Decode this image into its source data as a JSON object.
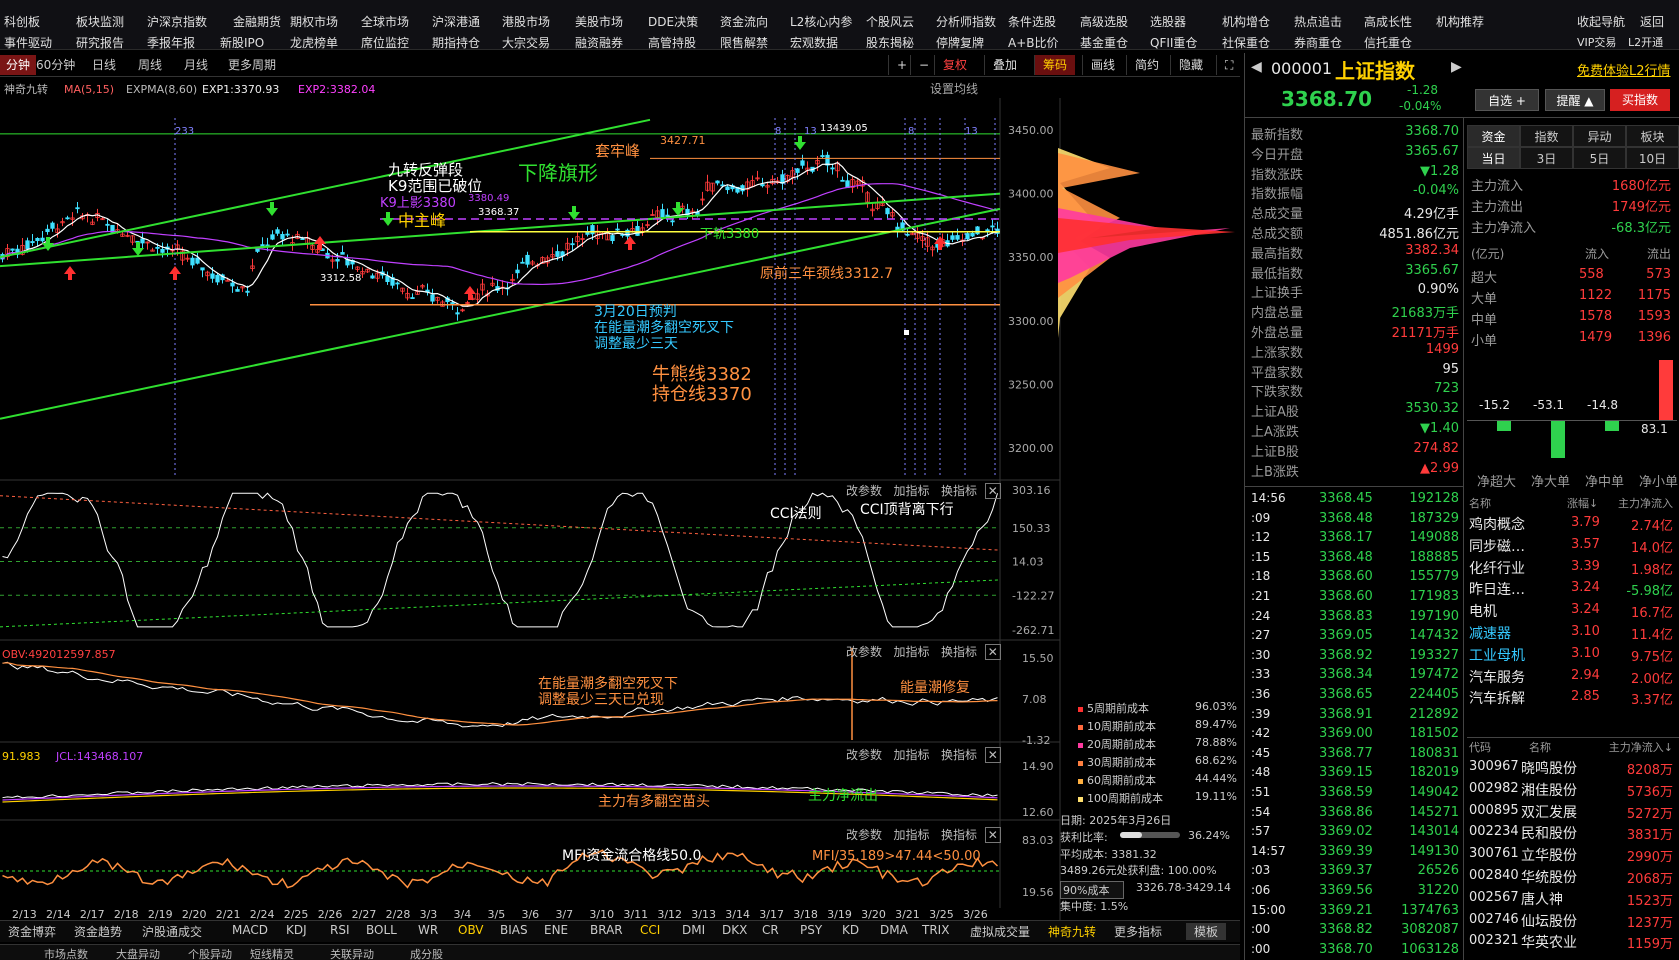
{
  "menu": {
    "row1": [
      "科创板",
      "板块监测",
      "沪深京指数",
      "金融期货",
      "期权市场",
      "全球市场",
      "沪深港通",
      "港股市场",
      "美股市场",
      "DDE决策",
      "资金流向",
      "L2核心内参",
      "个股风云",
      "分析师指数",
      "条件选股",
      "高级选股",
      "选股器",
      "机构增仓",
      "热点追击",
      "高成长性",
      "机构推荐"
    ],
    "row2": [
      "事件驱动",
      "研究报告",
      "季报年报",
      "新股IPO",
      "龙虎榜单",
      "席位监控",
      "期指持仓",
      "大宗交易",
      "融资融券",
      "高管持股",
      "限售解禁",
      "宏观数据",
      "股东揭秘",
      "停牌复牌",
      "A+B比价",
      "基金重仓",
      "QFII重仓",
      "社保重仓",
      "券商重仓",
      "信托重仓"
    ],
    "right1": [
      "收起导航",
      "返回"
    ],
    "right2": [
      "VIP交易",
      "L2开通"
    ]
  },
  "toolbar": {
    "periods": [
      "分钟",
      "60分钟",
      "日线",
      "周线",
      "月线",
      "更多周期"
    ],
    "right": [
      "复权",
      "叠加",
      "筹码",
      "画线",
      "简约",
      "隐藏"
    ]
  },
  "main_chart": {
    "indicators": [
      "神奇九转",
      "MA(5,15)",
      "EXPMA(8,60)",
      "EXP1:3370.93",
      "EXP2:3382.04"
    ],
    "settings": "设置均线",
    "yticks": [
      "3450.00",
      "3400.00",
      "3350.00",
      "3300.00",
      "3250.00",
      "3200.00"
    ],
    "annotations": {
      "taolaofeng": "套牢峰",
      "taolaofeng_val": "3427.71",
      "jiuzhuan": "九转反弹段",
      "k9": "K9范围已破位",
      "xiajiang": "下降旗形",
      "k9upper": "K9上影3380",
      "zhongzhufeng": "中主峰",
      "val_3380_49": "3380.49",
      "val_3368_37": "3368.37",
      "xiagui": "下轨3380",
      "neck": "原前三年颈线3312.7",
      "val_3312": "3312.58",
      "forecast1": "3月20日预判",
      "forecast2": "在能量潮多翻空死叉下",
      "forecast3": "调整最少三天",
      "bull1": "牛熊线3382",
      "bull2": "持仓线3370",
      "top_val": "13439.05"
    },
    "top_labels": [
      "233",
      "8",
      "13",
      "8",
      "13"
    ]
  },
  "cci_panel": {
    "tools": [
      "改参数",
      "加指标",
      "换指标"
    ],
    "yticks": [
      "303.16",
      "150.33",
      "14.03",
      "-122.27",
      "-262.71"
    ],
    "note1": "CCI法则",
    "note2": "CCI顶背离下行"
  },
  "obv_panel": {
    "label": "OBV:492012597.857",
    "tools": [
      "改参数",
      "加指标",
      "换指标"
    ],
    "yticks": [
      "15.50",
      "7.08",
      "-1.32"
    ],
    "note1": "在能量潮多翻空死叉下",
    "note2": "调整最少三天已兑现",
    "note3": "能量潮修复"
  },
  "fund_panel": {
    "label1": "91.983",
    "label2": "JCL:143468.107",
    "tools": [
      "改参数",
      "加指标",
      "换指标"
    ],
    "yticks": [
      "14.90",
      "12.60"
    ],
    "note1": "主力有多翻空苗头",
    "note2": "主力净流出"
  },
  "mfi_panel": {
    "tools": [
      "改参数",
      "加指标",
      "换指标"
    ],
    "yticks": [
      "83.03",
      "19.56"
    ],
    "note1": "MFI资金流合格线50.0",
    "note2": "MFI/35.189>47.44<50.00"
  },
  "xdates": [
    "2/13",
    "2/14",
    "2/17",
    "2/18",
    "2/19",
    "2/20",
    "2/21",
    "2/24",
    "2/25",
    "2/26",
    "2/27",
    "2/28",
    "3/3",
    "3/4",
    "3/5",
    "3/6",
    "3/7",
    "3/10",
    "3/11",
    "3/12",
    "3/13",
    "3/14",
    "3/17",
    "3/18",
    "3/19",
    "3/20",
    "3/21",
    "3/25",
    "3/26"
  ],
  "chips": {
    "costs": [
      {
        "label": "5周期前成本",
        "pct": "96.03%",
        "color": "#ff3030"
      },
      {
        "label": "10周期前成本",
        "pct": "89.47%",
        "color": "#ff6a3d"
      },
      {
        "label": "20周期前成本",
        "pct": "78.88%",
        "color": "#ff3aa0"
      },
      {
        "label": "30周期前成本",
        "pct": "68.62%",
        "color": "#ff8040"
      },
      {
        "label": "60周期前成本",
        "pct": "44.44%",
        "color": "#ffb040"
      },
      {
        "label": "100周期前成本",
        "pct": "19.11%",
        "color": "#ffe070"
      }
    ],
    "date": "日期: 2025年3月26日",
    "ratio_label": "获利比率:",
    "ratio": "36.24%",
    "avg": "平均成本: 3381.32",
    "range": "3489.26元处获利盘: 100.00%",
    "cost90": "90%成本",
    "cost90_val": "3326.78-3429.14",
    "concentration": "集中度: 1.5%"
  },
  "indicator_tabs": [
    "资金博弈",
    "资金趋势",
    "沪股通成交",
    "MACD",
    "KDJ",
    "RSI",
    "BOLL",
    "WR",
    "OBV",
    "BIAS",
    "ENE",
    "BRAR",
    "CCI",
    "DMI",
    "DKX",
    "CR",
    "PSY",
    "KD",
    "DMA",
    "TRIX",
    "虚拟成交量",
    "神奇九转",
    "更多指标",
    "模板"
  ],
  "bottom_tabs": [
    "",
    "市场点数",
    "大盘异动",
    "个股异动",
    "短线精灵",
    "关联异动",
    "成分股"
  ],
  "quote": {
    "code": "000001",
    "name": "上证指数",
    "promo": "免费体验L2行情",
    "price": "3368.70",
    "change": "-1.28",
    "pct": "-0.04%",
    "buttons": [
      "自选",
      "提醒",
      "买指数"
    ]
  },
  "stats": [
    {
      "label": "最新指数",
      "value": "3368.70",
      "color": "green"
    },
    {
      "label": "今日开盘",
      "value": "3365.67",
      "color": "green"
    },
    {
      "label": "指数涨跌",
      "value": "▼1.28",
      "color": "green"
    },
    {
      "label": "指数振幅",
      "value": "-0.04%",
      "color": "green"
    },
    {
      "label": "总成交量",
      "value": "4.29亿手",
      "color": "white"
    },
    {
      "label": "总成交额",
      "value": "4851.86亿元",
      "color": "white"
    },
    {
      "label": "最高指数",
      "value": "3382.34",
      "color": "red"
    },
    {
      "label": "最低指数",
      "value": "3365.67",
      "color": "green"
    },
    {
      "label": "上证换手",
      "value": "0.90%",
      "color": "white"
    },
    {
      "label": "内盘总量",
      "value": "21683万手",
      "color": "green"
    },
    {
      "label": "外盘总量",
      "value": "21171万手",
      "color": "red"
    },
    {
      "label": "上涨家数",
      "value": "1499",
      "color": "red"
    },
    {
      "label": "平盘家数",
      "value": "95",
      "color": "white"
    },
    {
      "label": "下跌家数",
      "value": "723",
      "color": "green"
    },
    {
      "label": "上证A股",
      "value": "3530.32",
      "color": "green"
    },
    {
      "label": "上A涨跌",
      "value": "▼1.40",
      "color": "green"
    },
    {
      "label": "上证B股",
      "value": "274.82",
      "color": "red"
    },
    {
      "label": "上B涨跌",
      "value": "▲2.99",
      "color": "red"
    }
  ],
  "ticks": [
    {
      "t": "14:56",
      "p": "3368.45",
      "v": "192128"
    },
    {
      "t": ":09",
      "p": "3368.48",
      "v": "187329"
    },
    {
      "t": ":12",
      "p": "3368.17",
      "v": "149088"
    },
    {
      "t": ":15",
      "p": "3368.48",
      "v": "188885"
    },
    {
      "t": ":18",
      "p": "3368.60",
      "v": "155779"
    },
    {
      "t": ":21",
      "p": "3368.60",
      "v": "171983"
    },
    {
      "t": ":24",
      "p": "3368.83",
      "v": "197190"
    },
    {
      "t": ":27",
      "p": "3369.05",
      "v": "147432"
    },
    {
      "t": ":30",
      "p": "3368.92",
      "v": "193327"
    },
    {
      "t": ":33",
      "p": "3368.34",
      "v": "197472"
    },
    {
      "t": ":36",
      "p": "3368.65",
      "v": "224405"
    },
    {
      "t": ":39",
      "p": "3368.91",
      "v": "212892"
    },
    {
      "t": ":42",
      "p": "3369.00",
      "v": "181502"
    },
    {
      "t": ":45",
      "p": "3368.77",
      "v": "180831"
    },
    {
      "t": ":48",
      "p": "3369.15",
      "v": "182019"
    },
    {
      "t": ":51",
      "p": "3368.59",
      "v": "149042"
    },
    {
      "t": ":54",
      "p": "3368.86",
      "v": "145271"
    },
    {
      "t": ":57",
      "p": "3369.02",
      "v": "143014"
    },
    {
      "t": "14:57",
      "p": "3369.39",
      "v": "149130"
    },
    {
      "t": ":03",
      "p": "3369.37",
      "v": "26526"
    },
    {
      "t": ":06",
      "p": "3369.56",
      "v": "31220"
    },
    {
      "t": "15:00",
      "p": "3369.21",
      "v": "1374763"
    },
    {
      "t": ":00",
      "p": "3368.82",
      "v": "3082087"
    },
    {
      "t": ":00",
      "p": "3368.70",
      "v": "1063128"
    }
  ],
  "fund": {
    "tabs1": [
      "资金",
      "指数",
      "异动",
      "板块"
    ],
    "tabs2": [
      "当日",
      "3日",
      "5日",
      "10日"
    ],
    "inflow_label": "主力流入",
    "inflow": "1680亿元",
    "outflow_label": "主力流出",
    "outflow": "1749亿元",
    "net_label": "主力净流入",
    "net": "-68.3亿元",
    "unit": "(亿元)",
    "in_h": "流入",
    "out_h": "流出",
    "rows": [
      {
        "label": "超大",
        "in": "558",
        "out": "573"
      },
      {
        "label": "大单",
        "in": "1122",
        "out": "1175"
      },
      {
        "label": "中单",
        "in": "1578",
        "out": "1593"
      },
      {
        "label": "小单",
        "in": "1479",
        "out": "1396"
      }
    ],
    "bars": [
      {
        "label": "净超大",
        "value": -15.2,
        "text": "-15.2"
      },
      {
        "label": "净大单",
        "value": -53.1,
        "text": "-53.1"
      },
      {
        "label": "净中单",
        "value": -14.8,
        "text": "-14.8"
      },
      {
        "label": "净小单",
        "value": 83.1,
        "text": "83.1"
      }
    ]
  },
  "sectors": {
    "headers": [
      "名称",
      "涨幅↓",
      "主力净流入"
    ],
    "rows": [
      {
        "name": "鸡肉概念",
        "pct": "3.79",
        "net": "2.74亿",
        "net_color": "red"
      },
      {
        "name": "同步磁…",
        "pct": "3.57",
        "net": "14.0亿",
        "net_color": "red"
      },
      {
        "name": "化纤行业",
        "pct": "3.39",
        "net": "1.98亿",
        "net_color": "red"
      },
      {
        "name": "昨日连…",
        "pct": "3.24",
        "net": "-5.98亿",
        "net_color": "green"
      },
      {
        "name": "电机",
        "pct": "3.24",
        "net": "16.7亿",
        "net_color": "red"
      },
      {
        "name": "减速器",
        "pct": "3.10",
        "net": "11.4亿",
        "net_color": "red"
      },
      {
        "name": "工业母机",
        "pct": "3.10",
        "net": "9.75亿",
        "net_color": "red"
      },
      {
        "name": "汽车服务",
        "pct": "2.94",
        "net": "2.00亿",
        "net_color": "red"
      },
      {
        "name": "汽车拆解",
        "pct": "2.85",
        "net": "3.37亿",
        "net_color": "red"
      }
    ]
  },
  "stocks": {
    "headers": [
      "代码",
      "名称",
      "主力净流入↓"
    ],
    "rows": [
      {
        "code": "300967",
        "name": "晓鸣股份",
        "net": "8208万"
      },
      {
        "code": "002982",
        "name": "湘佳股份",
        "net": "5736万"
      },
      {
        "code": "000895",
        "name": "双汇发展",
        "net": "5272万"
      },
      {
        "code": "002234",
        "name": "民和股份",
        "net": "3831万"
      },
      {
        "code": "300761",
        "name": "立华股份",
        "net": "2990万"
      },
      {
        "code": "002840",
        "name": "华统股份",
        "net": "2068万"
      },
      {
        "code": "002567",
        "name": "唐人神",
        "net": "1523万"
      },
      {
        "code": "002746",
        "name": "仙坛股份",
        "net": "1237万"
      },
      {
        "code": "002321",
        "name": "华英农业",
        "net": "1159万"
      }
    ]
  },
  "colors": {
    "up": "#ff3b3b",
    "down": "#2fd14e",
    "accent": "#ffd000",
    "bg": "#000000"
  }
}
